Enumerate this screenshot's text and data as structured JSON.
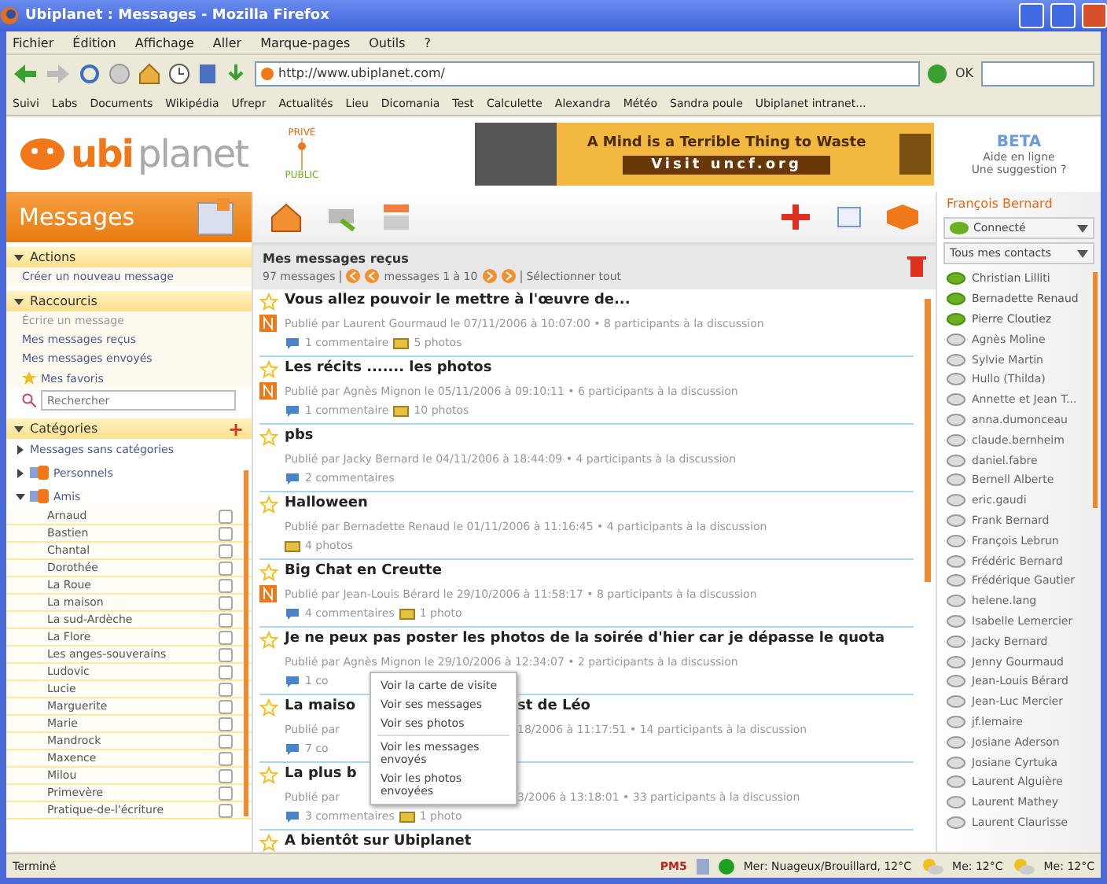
{
  "window": {
    "title": "Ubiplanet : Messages - Mozilla Firefox"
  },
  "menu": [
    "Fichier",
    "Édition",
    "Affichage",
    "Aller",
    "Marque-pages",
    "Outils",
    "?"
  ],
  "address": {
    "value": "http://www.ubiplanet.com/"
  },
  "go_label": "OK",
  "bookmarks": [
    "Suivi",
    "Labs",
    "Documents",
    "Wikipédia",
    "Ufrepr",
    "Actualités",
    "Lieu",
    "Dicomania",
    "Test",
    "Calculette",
    "Alexandra",
    "Météo",
    "Sandra poule",
    "Ubiplanet intranet..."
  ],
  "header": {
    "logo": {
      "ubi": "ubi",
      "planet": "planet"
    },
    "privacy": {
      "top": "PRIVÉ",
      "bottom": "PUBLIC"
    },
    "banner": {
      "headline": "A Mind is a Terrible Thing to Waste",
      "cta": "Visit uncf.org"
    },
    "beta": {
      "badge": "BETA",
      "help": "Aide en ligne",
      "suggest": "Une suggestion ?"
    }
  },
  "sidebar": {
    "title": "Messages",
    "sections": [
      {
        "title": "Actions",
        "expanded": true,
        "items": [
          {
            "label": "Créer un nouveau message"
          }
        ]
      },
      {
        "title": "Raccourcis",
        "expanded": true,
        "items": [
          {
            "label": "Écrire un message",
            "kind": "muted"
          },
          {
            "label": "Mes messages reçus",
            "kind": "link"
          },
          {
            "label": "Mes messages envoyés",
            "kind": "link"
          },
          {
            "label": "Mes favoris",
            "kind": "star"
          }
        ],
        "search": {
          "placeholder": "Rechercher"
        }
      },
      {
        "title": "Catégories",
        "expanded": true,
        "add": "+"
      }
    ],
    "tree": [
      {
        "label": "Messages sans catégories",
        "expanded": false,
        "icon": false
      },
      {
        "label": "Personnels",
        "expanded": false,
        "icon": true
      },
      {
        "label": "Amis",
        "expanded": true,
        "icon": true,
        "children": [
          {
            "label": "Arnaud",
            "checked": false
          },
          {
            "label": "Bastien",
            "checked": false
          },
          {
            "label": "Chantal",
            "checked": false
          },
          {
            "label": "Dorothée",
            "checked": false
          },
          {
            "label": "La Roue",
            "checked": false
          },
          {
            "label": "La maison",
            "checked": false
          },
          {
            "label": "La sud-Ardèche",
            "checked": false
          },
          {
            "label": "La Flore",
            "checked": false
          },
          {
            "label": "Les anges-souverains",
            "checked": false
          },
          {
            "label": "Ludovic",
            "checked": false
          },
          {
            "label": "Lucie",
            "checked": false
          },
          {
            "label": "Marguerite",
            "checked": false
          },
          {
            "label": "Marie",
            "checked": false
          },
          {
            "label": "Mandrock",
            "checked": false
          },
          {
            "label": "Maxence",
            "checked": false
          },
          {
            "label": "Milou",
            "checked": false
          },
          {
            "label": "Primevère",
            "checked": false
          },
          {
            "label": "Pratique-de-l'écriture",
            "checked": false
          }
        ]
      }
    ]
  },
  "inbox": {
    "title": "Mes messages reçus",
    "count": "97 messages",
    "range": "messages 1 à 10",
    "select_all": "Sélectionner tout",
    "messages": [
      {
        "title": "Vous allez pouvoir le mettre à l'œuvre de...",
        "is_new": true,
        "meta": "Publié par Laurent Gourmaud le 07/11/2006 à 10:07:00 • 8 participants à la discussion",
        "comments": "1 commentaire",
        "photos": "5 photos"
      },
      {
        "title": "Les récits ....... les photos",
        "is_new": true,
        "meta": "Publié par Agnès Mignon le 05/11/2006 à 09:10:11 • 6 participants à la discussion",
        "comments": "1 commentaire",
        "photos": "10 photos"
      },
      {
        "title": "pbs",
        "is_new": false,
        "meta": "Publié par Jacky Bernard le 04/11/2006 à 18:44:09 • 4 participants à la discussion",
        "comments": "2 commentaires"
      },
      {
        "title": "Halloween",
        "is_new": false,
        "meta": "Publié par Bernadette Renaud le 01/11/2006 à 11:16:45 • 4 participants à la discussion",
        "photos": "4 photos"
      },
      {
        "title": "Big Chat en Creutte",
        "is_new": true,
        "meta": "Publié par Jean-Louis Bérard le 29/10/2006 à 11:58:17 • 8 participants à la discussion",
        "comments": "4 commentaires",
        "photos": "1 photo"
      },
      {
        "title": "Je ne peux pas poster les photos de la soirée d'hier car je dépasse le quota",
        "is_new": false,
        "meta": "Publié par Agnès Mignon le 29/10/2006 à 12:34:07 • 2 participants à la discussion",
        "comments": "1 co"
      },
      {
        "title": "La maiso",
        "title_tail": "st de Léo",
        "is_new": false,
        "meta": "Publié par",
        "meta_tail": "18/2006 à 11:17:51 • 14 participants à la discussion",
        "comments": "7 co"
      },
      {
        "title": "La plus b",
        "is_new": false,
        "meta": "Publié par",
        "meta_tail": "3/2006 à 13:18:01 • 33 participants à la discussion",
        "comments": "3 commentaires",
        "photos": "1 photo"
      },
      {
        "title": "A bientôt sur Ubiplanet",
        "is_new": false
      }
    ],
    "context_menu": [
      "Voir la carte de visite",
      "Voir ses messages",
      "Voir ses photos",
      "Voir les messages envoyés",
      "Voir les photos envoyées"
    ]
  },
  "contacts": {
    "user": "François Bernard",
    "status": "Connecté",
    "filter": "Tous mes contacts",
    "items": [
      {
        "name": "Christian Lilliti",
        "online": true
      },
      {
        "name": "Bernadette Renaud",
        "online": true
      },
      {
        "name": "Pierre Cloutiez",
        "online": true
      },
      {
        "name": "Agnès Moline",
        "online": false
      },
      {
        "name": "Sylvie Martin",
        "online": false
      },
      {
        "name": "Hullo (Thilda)",
        "online": false
      },
      {
        "name": "Annette et Jean T...",
        "online": false
      },
      {
        "name": "anna.dumonceau",
        "online": false
      },
      {
        "name": "claude.bernheim",
        "online": false
      },
      {
        "name": "daniel.fabre",
        "online": false
      },
      {
        "name": "Bernell Alberte",
        "online": false
      },
      {
        "name": "eric.gaudi",
        "online": false
      },
      {
        "name": "Frank Bernard",
        "online": false
      },
      {
        "name": "François Lebrun",
        "online": false
      },
      {
        "name": "Frédéric Bernard",
        "online": false
      },
      {
        "name": "Frédérique Gautier",
        "online": false
      },
      {
        "name": "helene.lang",
        "online": false
      },
      {
        "name": "Isabelle Lemercier",
        "online": false
      },
      {
        "name": "Jacky Bernard",
        "online": false
      },
      {
        "name": "Jenny Gourmaud",
        "online": false
      },
      {
        "name": "Jean-Louis Bérard",
        "online": false
      },
      {
        "name": "Jean-Luc Mercier",
        "online": false
      },
      {
        "name": "jf.lemaire",
        "online": false
      },
      {
        "name": "Josiane Aderson",
        "online": false
      },
      {
        "name": "Josiane Cyrtuka",
        "online": false
      },
      {
        "name": "Laurent Alguière",
        "online": false
      },
      {
        "name": "Laurent Mathey",
        "online": false
      },
      {
        "name": "Laurent Claurisse",
        "online": false
      }
    ]
  },
  "status_bar": {
    "text": "Terminé",
    "mail": "PM5",
    "weather": "Mer: Nuageux/Brouillard, 12°C",
    "forecasts": [
      "Me: 12°C",
      "Me: 12°C"
    ]
  }
}
